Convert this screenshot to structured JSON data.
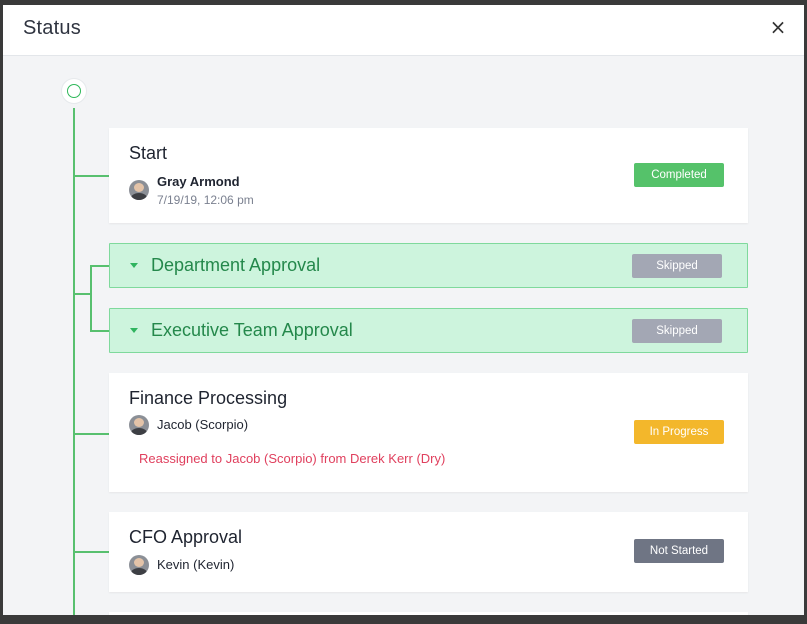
{
  "modal": {
    "title": "Status",
    "close_glyph": "×"
  },
  "steps": [
    {
      "title": "Start",
      "person": "Gray Armond",
      "date": "7/19/19, 12:06 pm",
      "status": "Completed",
      "status_color": "#55c26a"
    },
    {
      "title": "Department Approval",
      "status": "Skipped",
      "status_color": "#a3a7b4"
    },
    {
      "title": "Executive Team Approval",
      "status": "Skipped",
      "status_color": "#a3a7b4"
    },
    {
      "title": "Finance Processing",
      "person": "Jacob (Scorpio)",
      "note": "Reassigned to Jacob (Scorpio) from Derek Kerr (Dry)",
      "status": "In Progress",
      "status_color": "#f3b72b"
    },
    {
      "title": "CFO Approval",
      "person": "Kevin (Kevin)",
      "status": "Not Started",
      "status_color": "#6f7584"
    }
  ],
  "icons": {
    "close": "close-icon",
    "avatar": "avatar-icon",
    "caret": "caret-down-icon",
    "start": "start-circle-icon"
  },
  "colors": {
    "timeline": "#58c06f",
    "reassign_note": "#e0405e",
    "group_bg": "#cdf4dd"
  }
}
